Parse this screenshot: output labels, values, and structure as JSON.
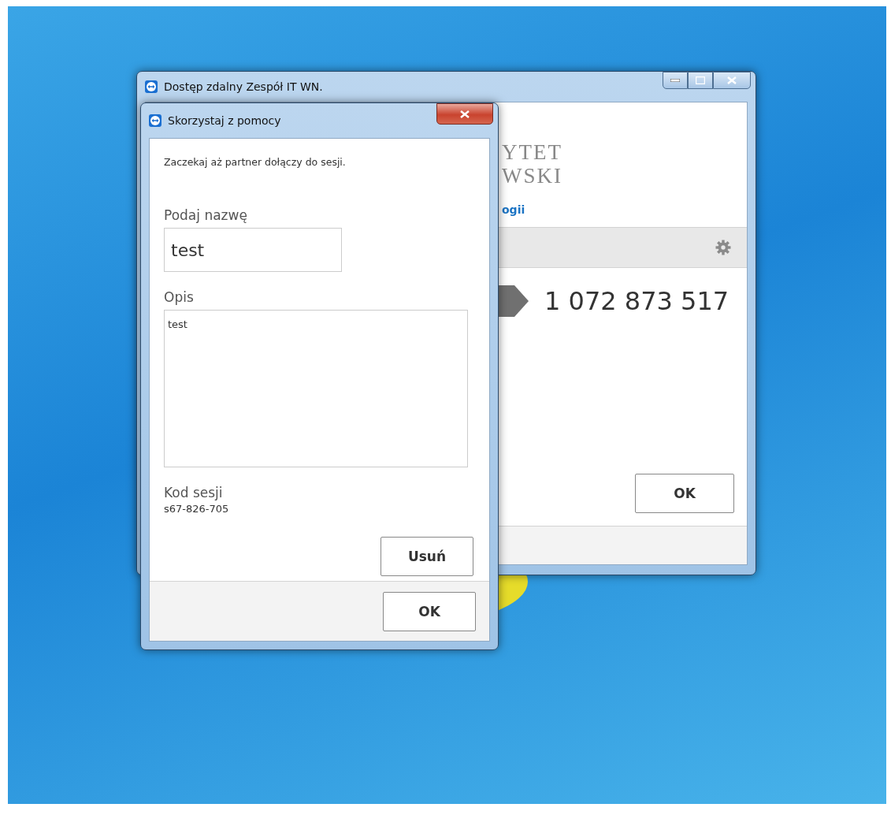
{
  "back_window": {
    "title": "Dostęp zdalny Zespół IT WN.",
    "logo_lines": [
      "YTET",
      "WSKI"
    ],
    "link": "ogii",
    "partner_id": "1 072 873 517",
    "ok_button": "OK"
  },
  "dialog": {
    "title": "Skorzystaj z pomocy",
    "message": "Zaczekaj aż partner dołączy do sesji.",
    "name_label": "Podaj nazwę",
    "name_value": "test",
    "description_label": "Opis",
    "description_value": "test",
    "session_label": "Kod sesji",
    "session_code": "s67-826-705",
    "delete_button": "Usuń",
    "ok_button": "OK"
  }
}
